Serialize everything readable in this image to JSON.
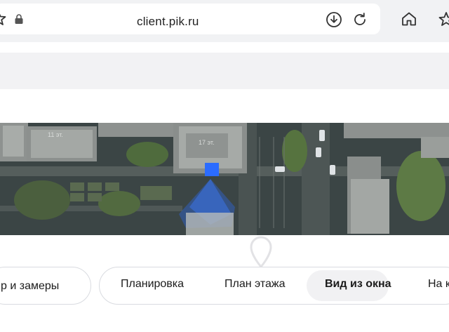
{
  "browser": {
    "url": "client.pik.ru",
    "icons": {
      "bookmark_left": "star-icon",
      "lock": "lock-icon",
      "download": "download-icon",
      "reload": "reload-icon",
      "home": "home-icon",
      "bookmark_right": "star-icon"
    }
  },
  "map": {
    "labels": [
      "11 эт.",
      "17 эт."
    ],
    "accent_color": "#2b6cff"
  },
  "tabs": {
    "partial_left_label": "р и замеры",
    "items": [
      {
        "label": "Планировка",
        "active": false
      },
      {
        "label": "План этажа",
        "active": false
      },
      {
        "label": "Вид из окна",
        "active": true
      },
      {
        "label": "На к",
        "active": false
      }
    ]
  }
}
